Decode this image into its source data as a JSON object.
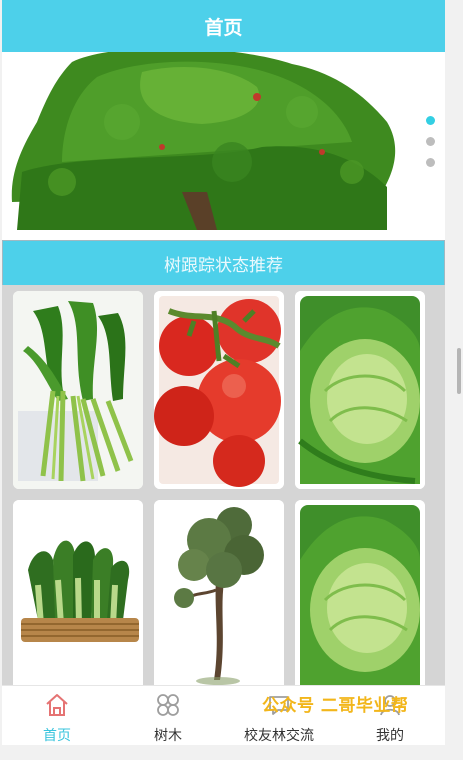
{
  "header": {
    "title": "首页"
  },
  "banner": {
    "slide_count": 3,
    "active_index": 0
  },
  "section": {
    "title": "树跟踪状态推荐"
  },
  "products": [
    {
      "name": "water-spinach-image"
    },
    {
      "name": "tomato-image"
    },
    {
      "name": "cabbage-image"
    },
    {
      "name": "bok-choy-basket-image"
    },
    {
      "name": "tree-image"
    },
    {
      "name": "cabbage-image-2"
    }
  ],
  "tabbar": {
    "items": [
      {
        "label": "首页",
        "icon": "home-icon",
        "active": true
      },
      {
        "label": "树木",
        "icon": "tree-grid-icon",
        "active": false
      },
      {
        "label": "校友林交流",
        "icon": "chat-icon",
        "active": false
      },
      {
        "label": "我的",
        "icon": "person-icon",
        "active": false
      }
    ]
  },
  "watermark": {
    "text": "公众号  二哥毕业帮"
  },
  "colors": {
    "accent": "#4dd0ea",
    "active_tab": "#38c4dd",
    "home_icon": "#e57373"
  }
}
